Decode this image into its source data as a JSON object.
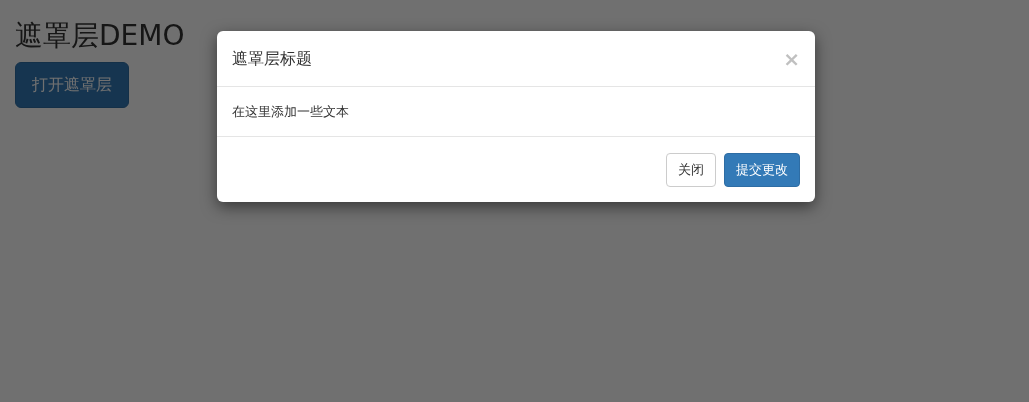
{
  "page": {
    "heading": "遮罩层DEMO",
    "open_button": "打开遮罩层"
  },
  "modal": {
    "title": "遮罩层标题",
    "close_icon": "×",
    "body": "在这里添加一些文本",
    "buttons": [
      {
        "label": "关闭",
        "kind": "default"
      },
      {
        "label": "提交更改",
        "kind": "primary"
      }
    ]
  }
}
